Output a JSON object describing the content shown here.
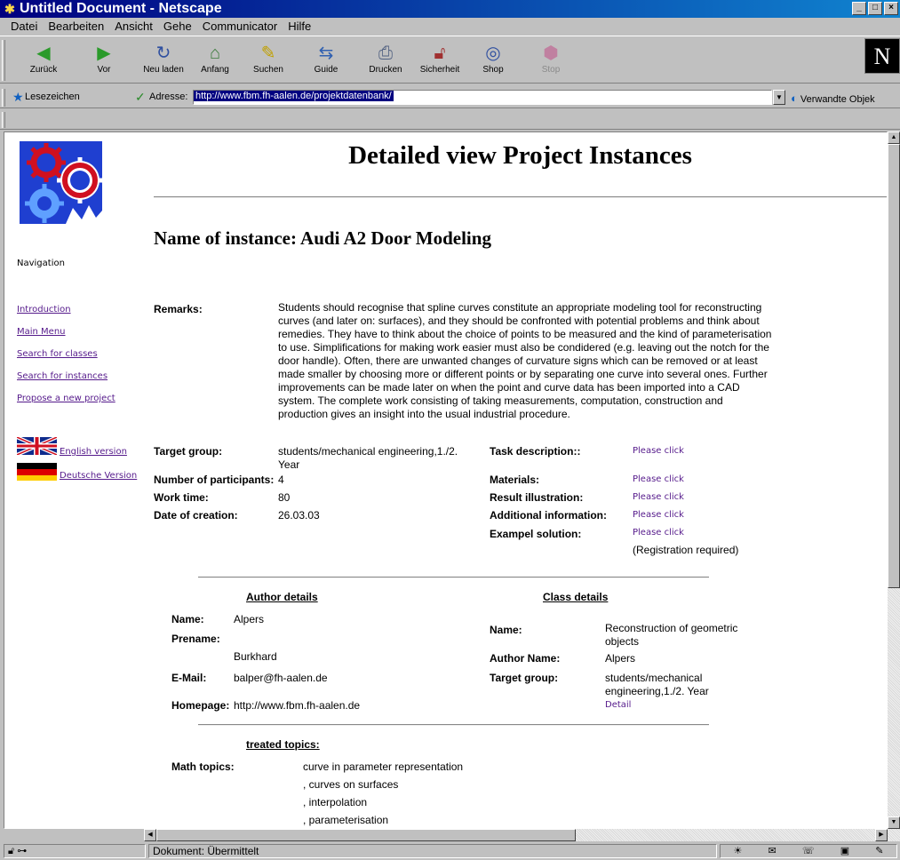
{
  "window": {
    "title": "Untitled Document - Netscape"
  },
  "menubar": [
    "Datei",
    "Bearbeiten",
    "Ansicht",
    "Gehe",
    "Communicator",
    "Hilfe"
  ],
  "toolbar": {
    "back": "Zurück",
    "forward": "Vor",
    "reload": "Neu laden",
    "home": "Anfang",
    "search": "Suchen",
    "guide": "Guide",
    "print": "Drucken",
    "security": "Sicherheit",
    "shop": "Shop",
    "stop": "Stop"
  },
  "locationbar": {
    "bookmarks": "Lesezeichen",
    "address_label": "Adresse:",
    "url": "http://www.fbm.fh-aalen.de/projektdatenbank/",
    "related": "Verwandte Objek"
  },
  "page": {
    "title": "Detailed view Project Instances",
    "instance_title": "Name of instance: Audi A2 Door Modeling",
    "navigation": {
      "title": "Navigation",
      "links": [
        "Introduction",
        "Main Menu",
        "Search for classes",
        "Search for instances",
        "Propose a new project"
      ],
      "english": "English version",
      "german": "Deutsche Version"
    },
    "remarks_label": "Remarks:",
    "remarks": "Students should recognise that spline curves constitute an appropriate modeling tool for reconstructing curves (and later on: surfaces), and they should be confronted with potential problems and think about remedies. They have to think about the choice of points to be measured and the kind of parameterisation to use. Simplifications for making work easier must also be condidered (e.g. leaving out the notch for the door handle). Often, there are unwanted changes of curvature signs which can be removed or at least made smaller by choosing more or different points or by separating one curve into several ones. Further improvements can be made later on when the point and curve data has been imported into a CAD system. The complete work consisting of taking measurements, computation, construction and production gives an insight into the usual industrial procedure.",
    "target_group_label": "Target group:",
    "target_group": "students/mechanical engineering,1./2. Year",
    "participants_label": "Number of participants:",
    "participants": "4",
    "work_time_label": "Work time:",
    "work_time": "80",
    "date_label": "Date of creation:",
    "date": "26.03.03",
    "task_label": "Task description::",
    "materials_label": "Materials:",
    "result_label": "Result illustration:",
    "additional_label": "Additional information:",
    "example_label": "Exampel solution:",
    "please_click": "Please click",
    "registration": "(Registration required)",
    "author": {
      "heading": "Author details",
      "name_label": "Name:",
      "name": "Alpers",
      "prename_label": "Prename:",
      "prename": "Burkhard",
      "email_label": "E-Mail:",
      "email": "balper@fh-aalen.de",
      "homepage_label": "Homepage:",
      "homepage": "http://www.fbm.fh-aalen.de"
    },
    "class": {
      "heading": "Class details",
      "name_label": "Name:",
      "name": "Reconstruction of geometric objects",
      "author_label": "Author Name:",
      "author": "Alpers",
      "target_label": "Target group:",
      "target": "students/mechanical engineering,1./2. Year",
      "detail": "Detail"
    },
    "topics": {
      "heading": "treated topics:",
      "math_label": "Math topics:",
      "items": [
        "curve in parameter representation",
        ", curves on surfaces",
        ", interpolation",
        ", parameterisation"
      ]
    }
  },
  "statusbar": {
    "text": "Dokument: Übermittelt"
  }
}
